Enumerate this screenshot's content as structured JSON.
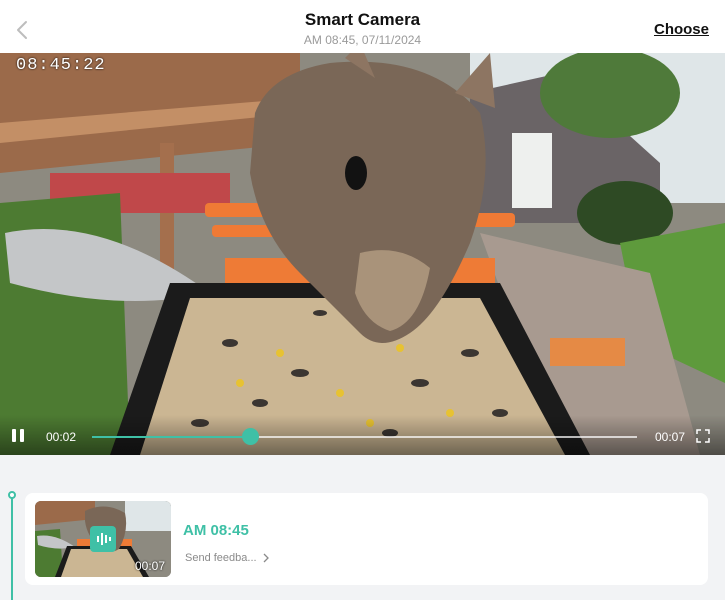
{
  "header": {
    "title": "Smart Camera",
    "subtitle": "AM 08:45, 07/11/2024",
    "choose_label": "Choose",
    "back_icon": "chevron-left-icon"
  },
  "video": {
    "osd_timestamp": "08:45:22",
    "current_time": "00:02",
    "duration": "00:07",
    "progress": 0.29,
    "icons": {
      "pause": "pause-icon",
      "fullscreen": "fullscreen-icon"
    }
  },
  "events": [
    {
      "time": "AM 08:45",
      "duration": "00:07",
      "feedback_label": "Send feedba...",
      "badge_icon": "sound-wave-icon"
    }
  ],
  "colors": {
    "accent": "#3fc0a6",
    "background": "#f2f3f5",
    "card": "#ffffff"
  }
}
